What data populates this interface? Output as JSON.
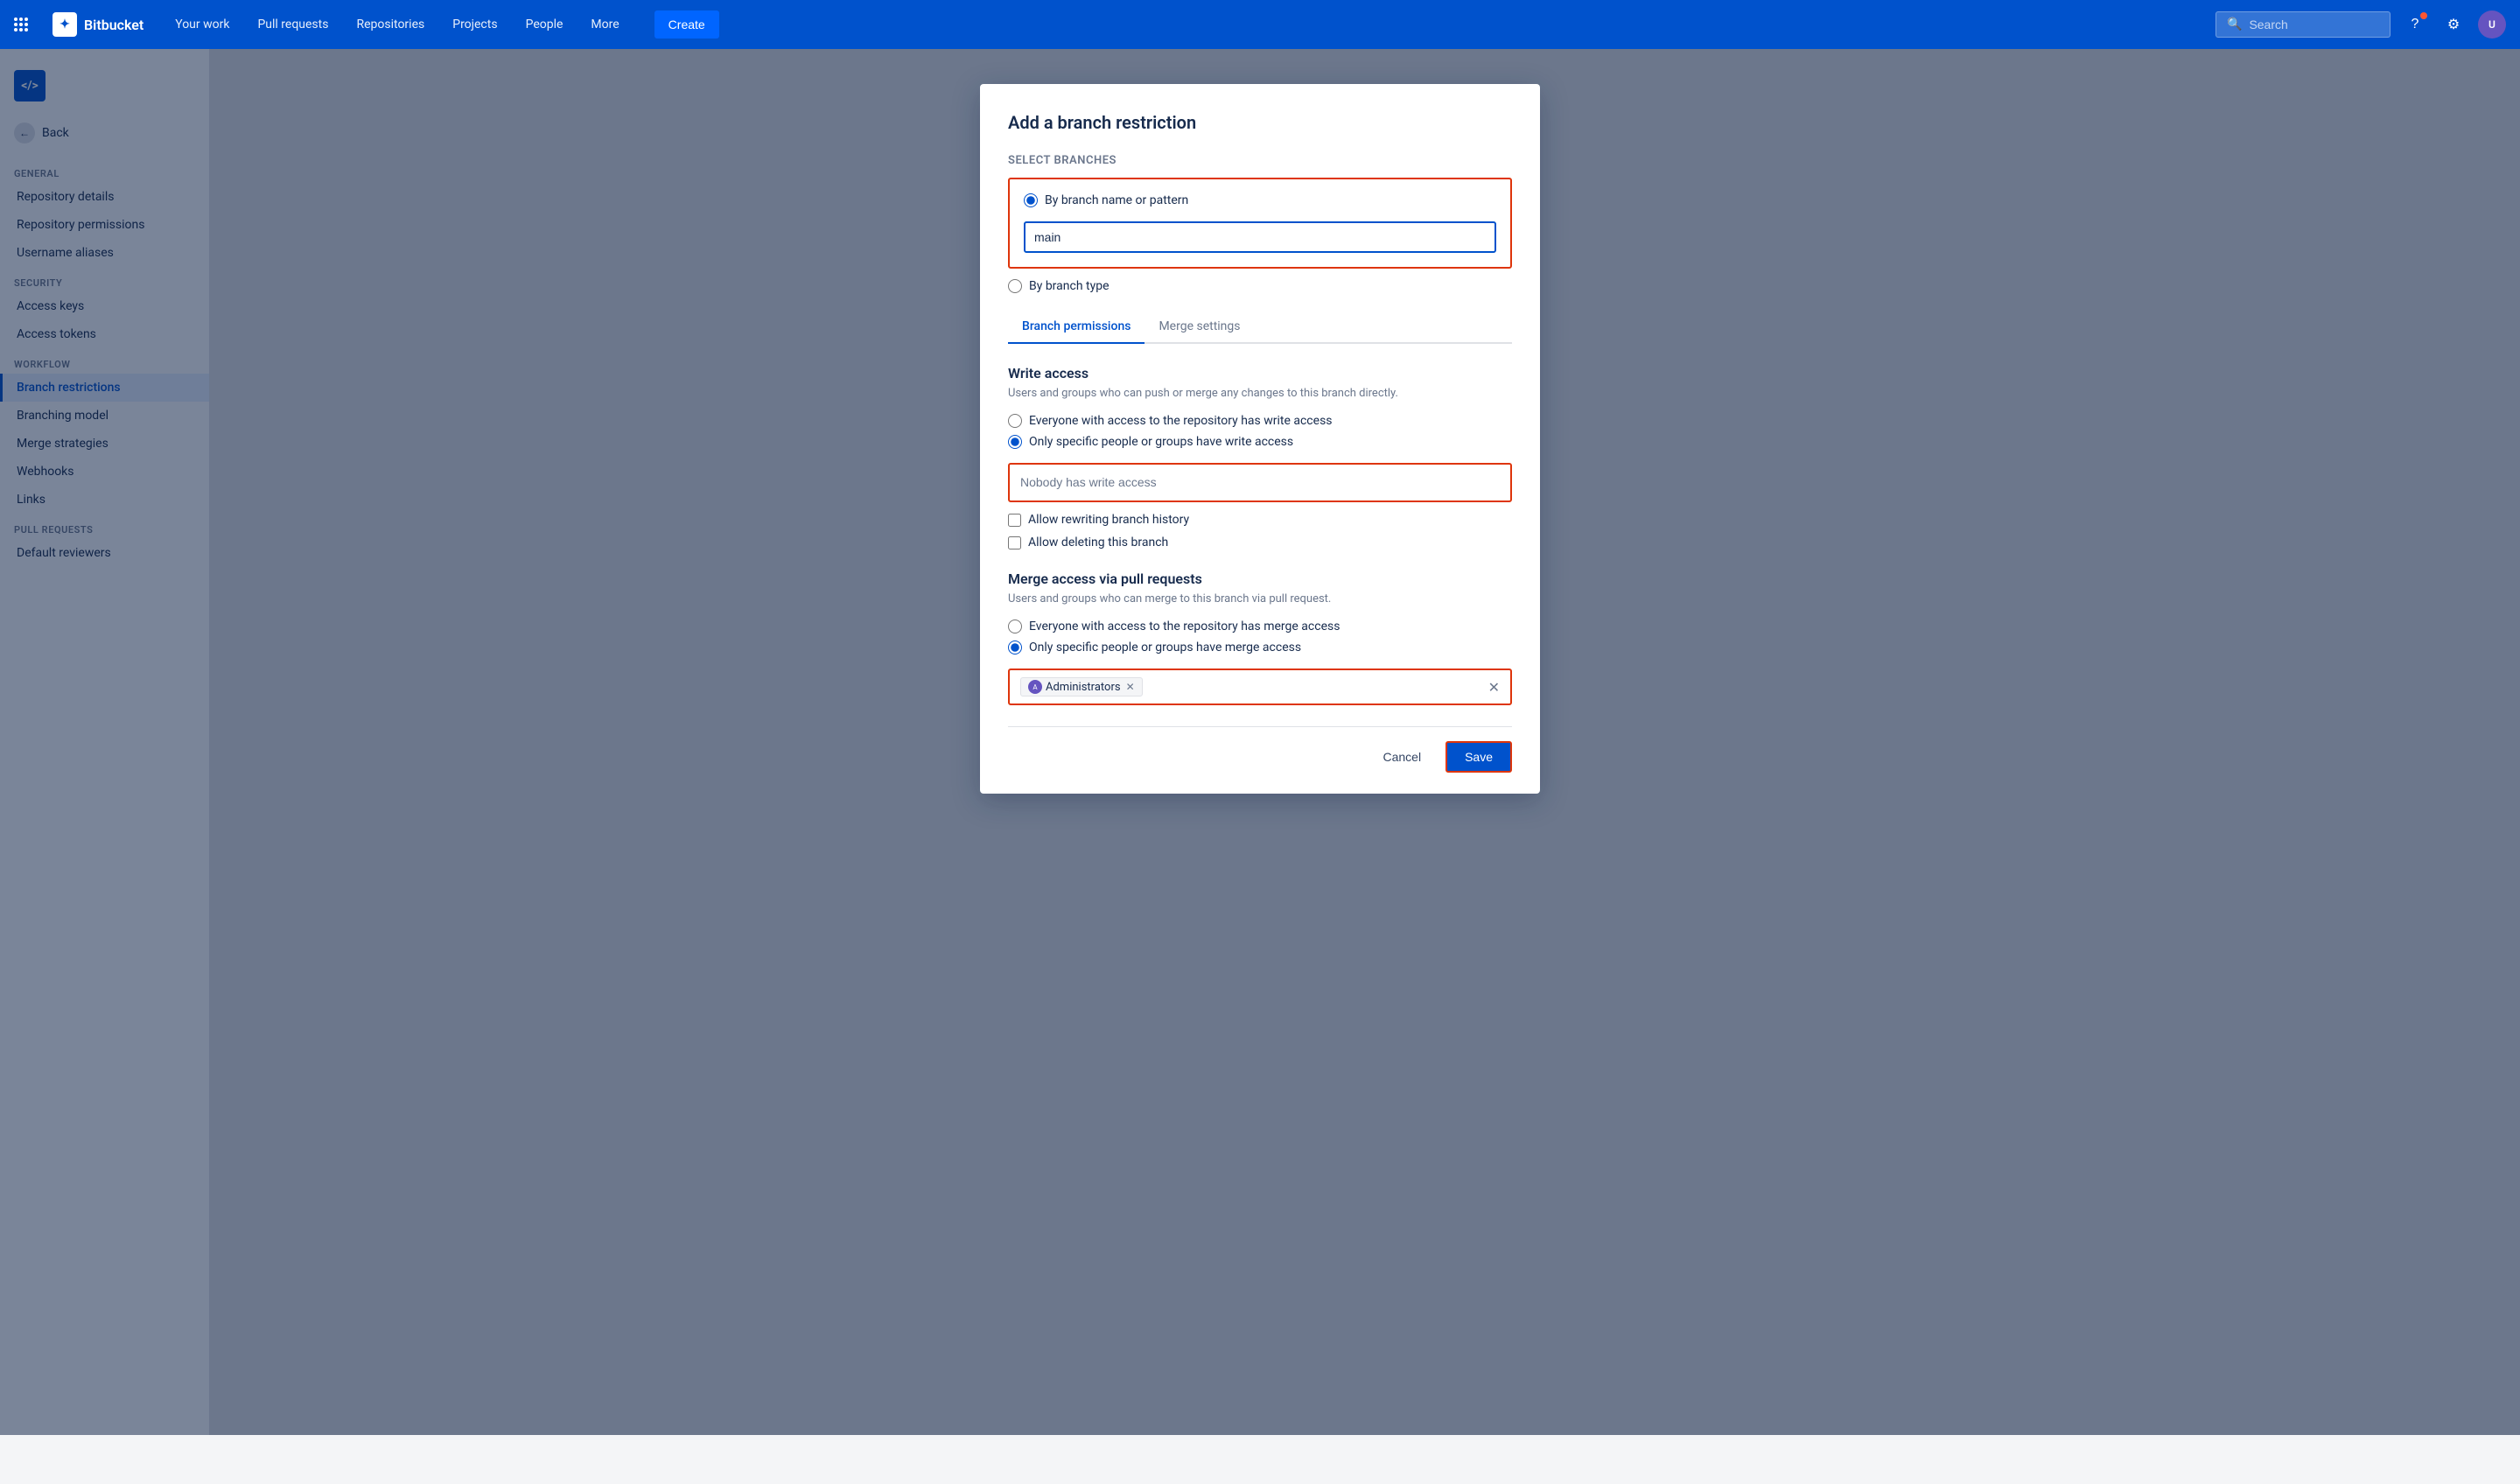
{
  "topnav": {
    "logo_text": "Bitbucket",
    "links": [
      "Your work",
      "Pull requests",
      "Repositories",
      "Projects",
      "People",
      "More"
    ],
    "create_label": "Create",
    "search_placeholder": "Search"
  },
  "sidebar": {
    "repo_icon": "</>",
    "back_label": "Back",
    "general_label": "GENERAL",
    "general_items": [
      {
        "id": "repository-details",
        "label": "Repository details"
      },
      {
        "id": "repository-permissions",
        "label": "Repository permissions"
      },
      {
        "id": "username-aliases",
        "label": "Username aliases"
      }
    ],
    "security_label": "SECURITY",
    "security_items": [
      {
        "id": "access-keys",
        "label": "Access keys"
      },
      {
        "id": "access-tokens",
        "label": "Access tokens"
      }
    ],
    "workflow_label": "WORKFLOW",
    "workflow_items": [
      {
        "id": "branch-restrictions",
        "label": "Branch restrictions",
        "active": true
      },
      {
        "id": "branching-model",
        "label": "Branching model"
      },
      {
        "id": "merge-strategies",
        "label": "Merge strategies"
      },
      {
        "id": "webhooks",
        "label": "Webhooks"
      },
      {
        "id": "links",
        "label": "Links"
      }
    ],
    "pull_requests_label": "PULL REQUESTS",
    "pull_requests_items": [
      {
        "id": "default-reviewers",
        "label": "Default reviewers"
      }
    ]
  },
  "modal": {
    "title": "Add a branch restriction",
    "select_branches_label": "Select branches",
    "branch_name_radio_label": "By branch name or pattern",
    "branch_input_value": "main",
    "branch_type_radio_label": "By branch type",
    "tabs": [
      {
        "id": "branch-permissions",
        "label": "Branch permissions",
        "active": true
      },
      {
        "id": "merge-settings",
        "label": "Merge settings",
        "active": false
      }
    ],
    "write_access": {
      "title": "Write access",
      "description": "Users and groups who can push or merge any changes to this branch directly.",
      "radio_everyone_label": "Everyone with access to the repository has write access",
      "radio_specific_label": "Only specific people or groups have write access",
      "people_placeholder": "Nobody has write access",
      "checkbox_rewrite_label": "Allow rewriting branch history",
      "checkbox_delete_label": "Allow deleting this branch"
    },
    "merge_access": {
      "title": "Merge access via pull requests",
      "description": "Users and groups who can merge to this branch via pull request.",
      "radio_everyone_label": "Everyone with access to the repository has merge access",
      "radio_specific_label": "Only specific people or groups have merge access",
      "tag_label": "Administrators",
      "input_placeholder": ""
    },
    "cancel_label": "Cancel",
    "save_label": "Save"
  }
}
